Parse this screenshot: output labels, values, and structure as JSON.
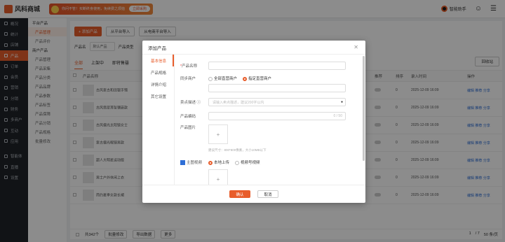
{
  "brand": {
    "name": "风科商城"
  },
  "promo": {
    "text": "你问不管！买断终身使用，免续费之烦恼",
    "button": "立即采购"
  },
  "topbar": {
    "assistant": "智能助手"
  },
  "sidebar": {
    "items": [
      {
        "label": "概况",
        "icon": "dashboard-icon"
      },
      {
        "label": "统计",
        "icon": "chart-icon"
      },
      {
        "label": "店铺",
        "icon": "shop-icon"
      },
      {
        "label": "产品",
        "icon": "product-icon",
        "active": true
      },
      {
        "label": "订单",
        "icon": "order-icon"
      },
      {
        "label": "会员",
        "icon": "member-icon"
      },
      {
        "label": "营销",
        "icon": "marketing-icon"
      },
      {
        "label": "分销",
        "icon": "distribution-icon"
      },
      {
        "label": "财务",
        "icon": "finance-icon"
      },
      {
        "label": "多商户",
        "icon": "merchant-icon"
      },
      {
        "label": "互动",
        "icon": "interact-icon"
      },
      {
        "label": "应用",
        "icon": "app-icon"
      },
      {
        "label": "智能体",
        "icon": "ai-icon"
      },
      {
        "label": "直播",
        "icon": "live-icon"
      },
      {
        "label": "设置",
        "icon": "settings-icon"
      }
    ]
  },
  "subside": {
    "group1": "平台产品",
    "group1_items": [
      "产品管理",
      "产品评价"
    ],
    "group2": "商户产品",
    "group2_items": [
      "产品管理",
      "产品采集",
      "产品分类",
      "产品品牌",
      "产品参数",
      "产品标签",
      "产品保障",
      "产品分销",
      "产品规格",
      "批量修改"
    ]
  },
  "main": {
    "toolbar": {
      "add": "+ 添加产品",
      "import1": "从平台导入",
      "import2": "从电商平台导入"
    },
    "filters": {
      "name_label": "产品名",
      "name_value": "默认产品",
      "status_label": "产品类型"
    },
    "tabs": [
      "全部",
      "上架中",
      "即将售罄"
    ],
    "recycle": "回收站",
    "headers": {
      "name": "产品名称",
      "shelf": "上架",
      "recommend": "推荐",
      "sort": "排序",
      "time": "录入时间",
      "op": "操作"
    },
    "rows": [
      {
        "name": "古风复古和田银手镯",
        "time": "2025-12-09 16:09",
        "on": true
      },
      {
        "name": "古风翡翠耳坠镶嵌款",
        "time": "2025-12-09 16:09",
        "on": true
      },
      {
        "name": "古风偏光太阳镜女士",
        "time": "2025-12-09 16:09",
        "on": true
      },
      {
        "name": "复古偏光眼镜男款",
        "time": "2025-12-09 16:09",
        "on": true
      },
      {
        "name": "超人大明星运动版",
        "time": "2025-12-09 16:09",
        "on": true
      },
      {
        "name": "男士户外休闲上衣",
        "time": "2025-12-09 16:09",
        "on": true
      },
      {
        "name": "简约夏季女款长裙",
        "time": "2025-12-09 16:09",
        "on": true
      }
    ],
    "row_price": "¥ 280",
    "row_zero": "0",
    "ops": [
      "编辑",
      "推荐",
      "分享"
    ],
    "bottom": {
      "total": "共342个",
      "batch_edit": "批量修改",
      "export": "导出数据",
      "more": "更多",
      "page": "1",
      "page_total": "/ 7",
      "per_page": "50 条/页"
    }
  },
  "modal": {
    "title": "添加产品",
    "nav": [
      "基本信息",
      "产品规格",
      "详情介绍",
      "其它设置"
    ],
    "fields": {
      "name_label": "产品名称",
      "sync_label": "同步商户",
      "sync_opt1": "全部直营商户",
      "sync_opt2": "指定直营商户",
      "share_label": "卖点描述",
      "share_placeholder": "请输入卖点描述，建议200字以内",
      "code_label": "产品编码",
      "code_count": "0 / 50",
      "image_label": "产品图片",
      "image_hint": "建议尺寸：800*800像素，大小10MB以下",
      "video_label": "主图视频",
      "video_opt1": "本地上传",
      "video_opt2": "视频号视频"
    },
    "ok": "确认",
    "cancel": "取消"
  }
}
